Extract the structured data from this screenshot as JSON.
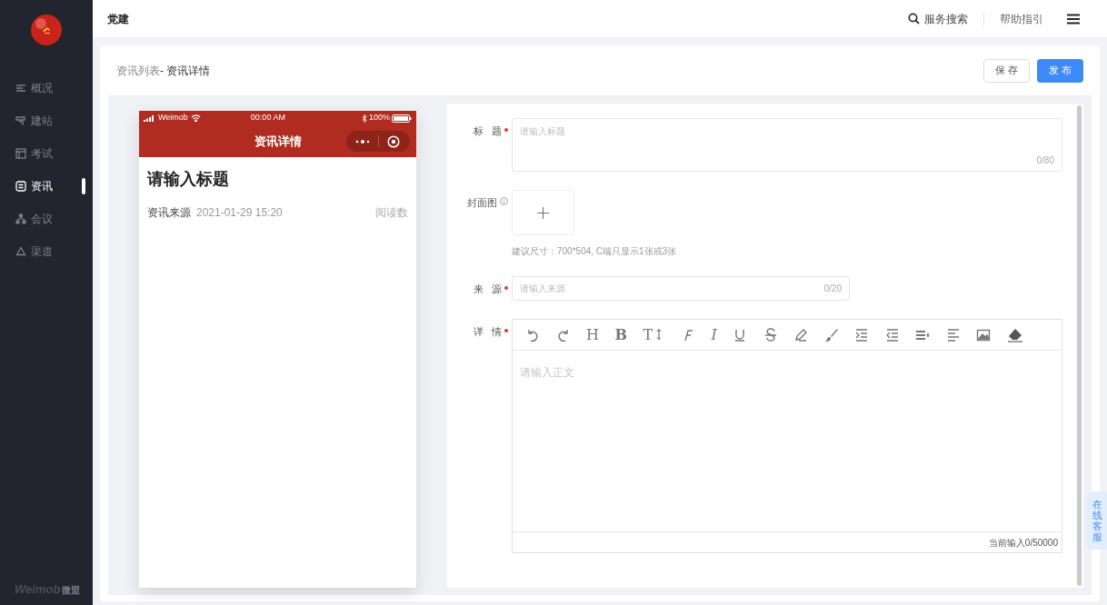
{
  "sidebar": {
    "items": [
      {
        "label": "概况",
        "selected": false
      },
      {
        "label": "建站",
        "selected": false
      },
      {
        "label": "考试",
        "selected": false
      },
      {
        "label": "资讯",
        "selected": true
      },
      {
        "label": "会议",
        "selected": false
      },
      {
        "label": "渠道",
        "selected": false
      }
    ],
    "footer": {
      "brand": "Weimob",
      "brand_cn": "微盟"
    }
  },
  "topbar": {
    "title": "党建",
    "search": "服务搜索",
    "help": "帮助指引"
  },
  "breadcrumb": {
    "parent": "资讯列表",
    "current": "- 资讯详情"
  },
  "actions": {
    "save": "保 存",
    "publish": "发 布"
  },
  "phone": {
    "carrier": "Weimob",
    "time": "00:00 AM",
    "battery": "100%",
    "nav_title": "资讯详情",
    "article_title": "请输入标题",
    "source": "资讯来源",
    "date": "2021-01-29 15:20",
    "reads": "阅读数"
  },
  "form": {
    "title": {
      "label": "标 题",
      "required": true,
      "placeholder": "请输入标题",
      "counter": "0/80"
    },
    "cover": {
      "label": "封面图",
      "hint": "建议尺寸：700*504, C端只显示1张或3张"
    },
    "source": {
      "label": "来 源",
      "required": true,
      "placeholder": "请输入来源",
      "counter": "0/20"
    },
    "detail": {
      "label": "详 情",
      "required": true,
      "placeholder": "请输入正文",
      "counter": "当前输入0/50000",
      "toolbar": [
        {
          "kind": "undo"
        },
        {
          "kind": "redo"
        },
        {
          "kind": "glyph",
          "text": "H"
        },
        {
          "kind": "glyph",
          "text": "B",
          "bold": true
        },
        {
          "kind": "glyph",
          "text": "T↕"
        },
        {
          "kind": "font"
        },
        {
          "kind": "glyph",
          "text": "I",
          "italic": true
        },
        {
          "kind": "underline"
        },
        {
          "kind": "strike"
        },
        {
          "kind": "pen"
        },
        {
          "kind": "brush"
        },
        {
          "kind": "indent"
        },
        {
          "kind": "outdent"
        },
        {
          "kind": "lineheight"
        },
        {
          "kind": "align"
        },
        {
          "kind": "image"
        },
        {
          "kind": "eraser"
        }
      ]
    }
  },
  "service_tab": "在线客服"
}
